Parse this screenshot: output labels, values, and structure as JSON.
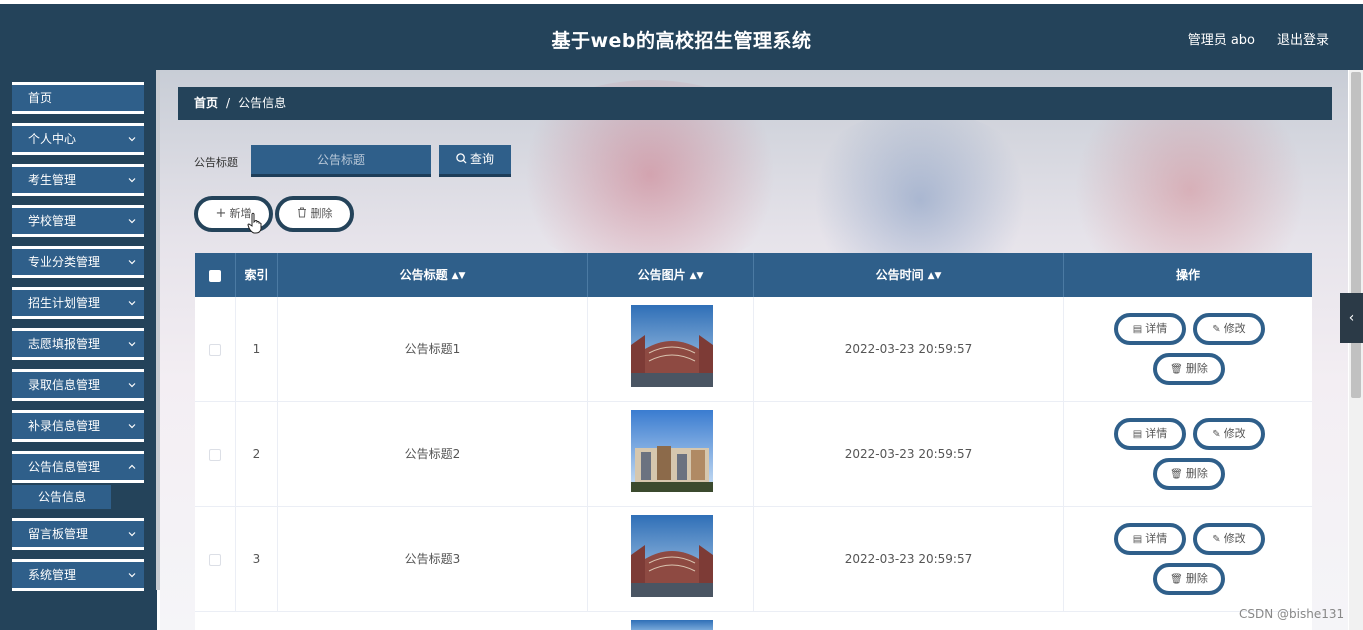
{
  "app": {
    "title": "基于web的高校招生管理系统",
    "user": "管理员 abo",
    "logout": "退出登录"
  },
  "sidebar": {
    "items": [
      {
        "label": "首页"
      },
      {
        "label": "个人中心"
      },
      {
        "label": "考生管理"
      },
      {
        "label": "学校管理"
      },
      {
        "label": "专业分类管理"
      },
      {
        "label": "招生计划管理"
      },
      {
        "label": "志愿填报管理"
      },
      {
        "label": "录取信息管理"
      },
      {
        "label": "补录信息管理"
      },
      {
        "label": "公告信息管理"
      },
      {
        "label": "留言板管理"
      },
      {
        "label": "系统管理"
      }
    ],
    "active_sub": "公告信息"
  },
  "breadcrumb": {
    "home": "首页",
    "sep": "/",
    "current": "公告信息"
  },
  "search": {
    "label": "公告标题",
    "placeholder": "公告标题",
    "button": "查询"
  },
  "toolbar": {
    "add": "新增",
    "delete": "删除"
  },
  "table": {
    "headers": {
      "index": "索引",
      "title": "公告标题",
      "image": "公告图片",
      "time": "公告时间",
      "ops": "操作"
    },
    "rows": [
      {
        "index": "1",
        "title": "公告标题1",
        "time": "2022-03-23 20:59:57",
        "image": "building-photo-1"
      },
      {
        "index": "2",
        "title": "公告标题2",
        "time": "2022-03-23 20:59:57",
        "image": "building-photo-2"
      },
      {
        "index": "3",
        "title": "公告标题3",
        "time": "2022-03-23 20:59:57",
        "image": "building-photo-1"
      }
    ],
    "ops": {
      "detail": "详情",
      "edit": "修改",
      "delete": "删除"
    }
  },
  "watermark": "CSDN @bishe131",
  "colors": {
    "header": "#24435a",
    "accent": "#2f5f8a"
  }
}
